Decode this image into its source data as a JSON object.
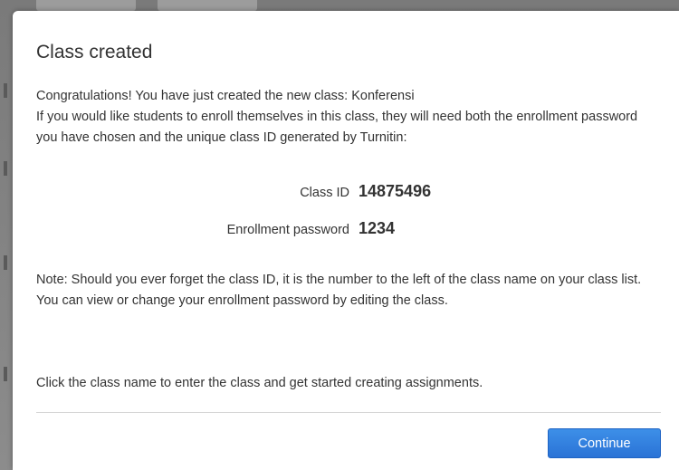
{
  "dialog": {
    "title": "Class created",
    "intro_line1": "Congratulations! You have just created the new class: Konferensi",
    "intro_line2": "If you would like students to enroll themselves in this class, they will need both the enrollment password you have chosen and the unique class ID generated by Turnitin:",
    "class_id_label": "Class ID",
    "class_id_value": "14875496",
    "enrollment_password_label": "Enrollment password",
    "enrollment_password_value": "1234",
    "note": "Note: Should you ever forget the class ID, it is the number to the left of the class name on your class list. You can view or change your enrollment password by editing the class.",
    "hint": "Click the class name to enter the class and get started creating assignments.",
    "continue_label": "Continue"
  },
  "colors": {
    "button_blue": "#2a73d6",
    "text": "#333333",
    "overlay": "#8a8a8a"
  }
}
